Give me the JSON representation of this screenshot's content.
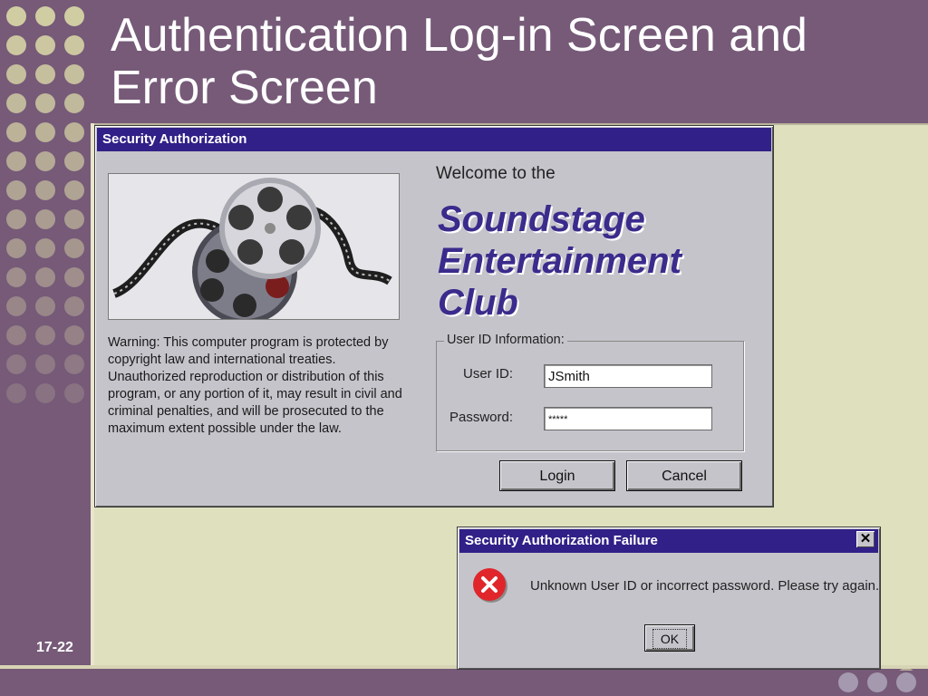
{
  "slide": {
    "title": "Authentication Log-in Screen and Error Screen",
    "number": "17-22"
  },
  "login_window": {
    "title": "Security Authorization",
    "warning": "Warning: This computer program is protected by copyright law and international treaties. Unauthorized reproduction or distribution of this program, or any portion of it, may result in civil and criminal penalties, and will be prosecuted to the maximum extent possible under the law.",
    "welcome": "Welcome to the",
    "brand_line1": "Soundstage",
    "brand_line2": "Entertainment",
    "brand_line3": "Club",
    "group_label": "User ID Information:",
    "user_id_label": "User ID:",
    "user_id_value": "JSmith",
    "password_label": "Password:",
    "password_value": "*****",
    "login_button": "Login",
    "cancel_button": "Cancel"
  },
  "error_window": {
    "title": "Security Authorization Failure",
    "close_symbol": "✕",
    "message": "Unknown User ID or incorrect password.  Please try again.",
    "ok_button": "OK"
  },
  "colors": {
    "background": "#765a78",
    "content": "#dfe0be",
    "titlebar": "#312087",
    "brand": "#3a2b8c",
    "error_icon": "#e0262b"
  },
  "icons": {
    "film_reels": "film-reel-image",
    "error": "error-x-icon"
  }
}
